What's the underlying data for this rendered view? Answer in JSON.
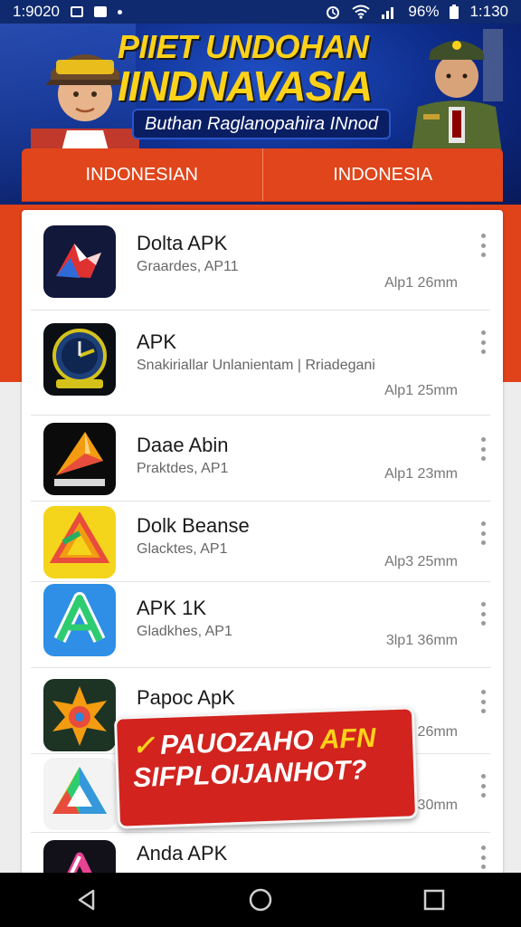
{
  "status_bar": {
    "time_left": "1:9020",
    "time_right": "1:130",
    "battery": "96%"
  },
  "banner": {
    "title_line1": "PIIET UNDOHAN",
    "title_line2": "IINDNAVASIA",
    "subtitle": "Buthan Raglanopahira INnod"
  },
  "tabs": [
    {
      "label": "INDONESIAN"
    },
    {
      "label": "INDONESIA"
    }
  ],
  "apps": [
    {
      "name": "Dolta APK",
      "desc": "Graardes, AP11",
      "size": "Alp1 26mm",
      "icon": "delta-logo-icon"
    },
    {
      "name": "APK",
      "desc": "Snakiriallar Unlanientam | Rriadegani",
      "size": "Alp1 25mm",
      "icon": "clock-emblem-icon"
    },
    {
      "name": "Daae Abin",
      "desc": "Praktdes, AP1",
      "size": "Alp1 23mm",
      "icon": "orange-arrow-icon"
    },
    {
      "name": "Dolk Beanse",
      "desc": "Glacktes, AP1",
      "size": "Alp3 25mm",
      "icon": "yellow-triangle-icon"
    },
    {
      "name": "APK 1K",
      "desc": "Gladkhes, AP1",
      "size": "3lp1 36mm",
      "icon": "green-a-icon"
    },
    {
      "name": "Papoc ApK",
      "desc": "",
      "size": "26mm",
      "icon": "sunburst-icon"
    },
    {
      "name": "",
      "desc": "",
      "size": "30mm",
      "icon": "rainbow-triangle-icon"
    },
    {
      "name": "Anda APK",
      "desc": "",
      "size": "",
      "icon": "pink-a-icon"
    }
  ],
  "promo": {
    "check": "✓",
    "line1_white": "PAUOZAHO ",
    "line1_yellow": "AFN",
    "line2": "SIFPLOIJANHOT?"
  },
  "colors": {
    "banner_blue": "#0d2a86",
    "accent_red": "#e0421a",
    "title_yellow": "#ffd21a"
  }
}
